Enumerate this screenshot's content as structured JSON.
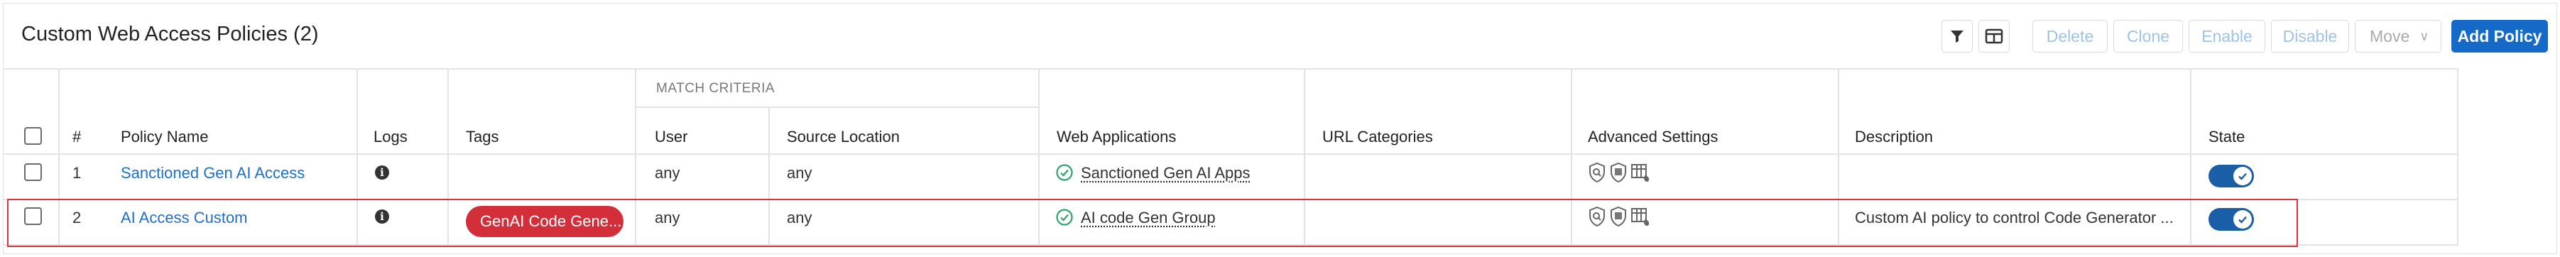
{
  "header": {
    "title": "Custom Web Access Policies (2)"
  },
  "toolbar": {
    "filter_icon": "filter-icon",
    "columns_icon": "columns-icon",
    "delete": "Delete",
    "clone": "Clone",
    "enable": "Enable",
    "disable": "Disable",
    "move": "Move",
    "add_policy": "Add Policy"
  },
  "table": {
    "group_header": "MATCH CRITERIA",
    "columns": {
      "num": "#",
      "policy_name": "Policy Name",
      "logs": "Logs",
      "tags": "Tags",
      "user": "User",
      "source_location": "Source Location",
      "web_applications": "Web Applications",
      "url_categories": "URL Categories",
      "advanced_settings": "Advanced Settings",
      "description": "Description",
      "state": "State"
    },
    "rows": [
      {
        "num": "1",
        "policy_name": "Sanctioned Gen AI Access",
        "tag": "",
        "user": "any",
        "source_location": "any",
        "web_application": "Sanctioned Gen AI Apps",
        "url_categories": "",
        "description": "",
        "state_enabled": true
      },
      {
        "num": "2",
        "policy_name": "AI Access Custom",
        "tag": "GenAI Code Gene...",
        "user": "any",
        "source_location": "any",
        "web_application": "AI code Gen Group",
        "url_categories": "",
        "description": "Custom AI policy to control Code Generator ...",
        "state_enabled": true
      }
    ]
  },
  "colors": {
    "link": "#1e6fc8",
    "primary_button": "#1569c7",
    "toggle_on": "#1a5ea8",
    "tag_red": "#d32f3a",
    "highlight_border": "#d9343c",
    "success_green": "#2ea36b"
  }
}
